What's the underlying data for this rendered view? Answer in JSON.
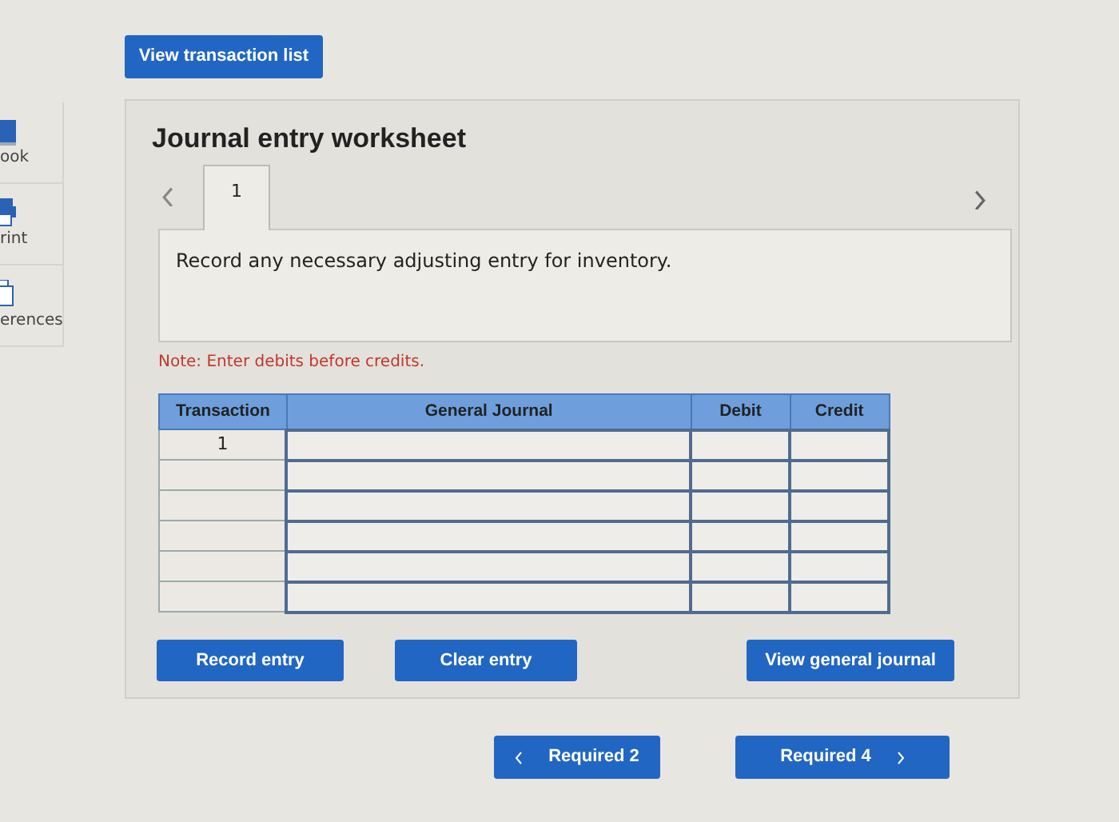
{
  "sidebar": {
    "items": [
      {
        "label": "ook",
        "kind": "book"
      },
      {
        "label": "rint",
        "kind": "print"
      },
      {
        "label": "erences",
        "kind": "copies"
      }
    ]
  },
  "top_button": "View transaction list",
  "worksheet": {
    "title": "Journal entry worksheet",
    "tabs": [
      {
        "label": "1",
        "selected": true
      }
    ],
    "instruction": "Record any necessary adjusting entry for inventory.",
    "note": "Note: Enter debits before credits.",
    "table": {
      "columns": [
        "Transaction",
        "General Journal",
        "Debit",
        "Credit"
      ],
      "rows": [
        {
          "transaction": "1"
        },
        {},
        {},
        {},
        {},
        {}
      ]
    },
    "buttons": [
      "Record entry",
      "Clear entry",
      "View general journal"
    ]
  },
  "nav": {
    "previous": "Required 2",
    "next": "Required 4"
  }
}
